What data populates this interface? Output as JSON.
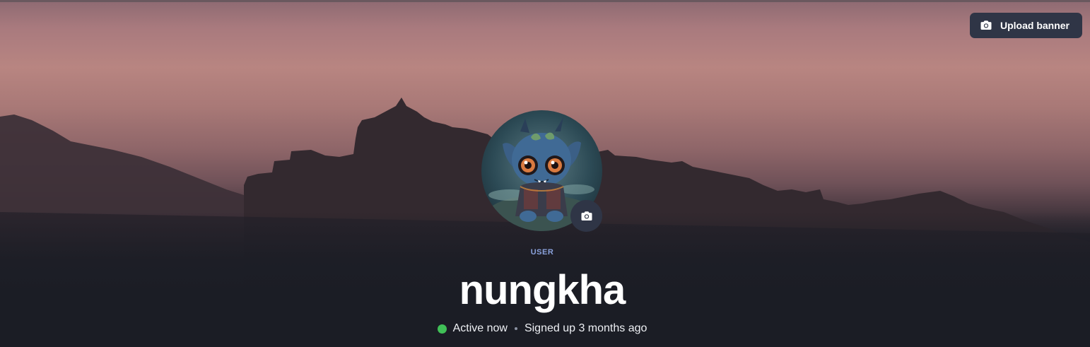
{
  "banner": {
    "upload_label": "Upload banner",
    "upload_icon": "camera-icon"
  },
  "avatar": {
    "camera_icon": "camera-icon"
  },
  "profile": {
    "role": "USER",
    "username": "nungkha",
    "status": "Active now",
    "signed_up": "Signed up 3 months ago",
    "status_color": "#40c057",
    "role_color": "#8aa2dc"
  }
}
